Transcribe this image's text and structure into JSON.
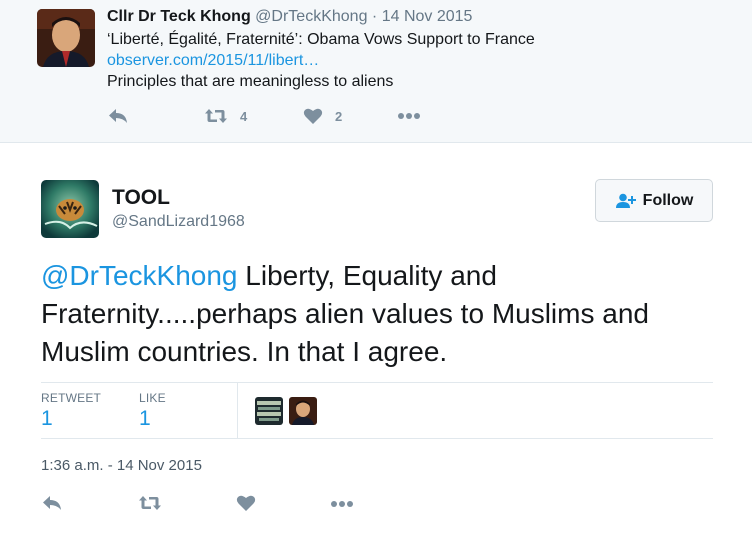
{
  "parent": {
    "name": "Cllr Dr Teck Khong",
    "handle": "@DrTeckKhong",
    "separator": "·",
    "date": "14 Nov 2015",
    "line1": "‘Liberté, Égalité, Fraternité’: Obama Vows Support to France",
    "link": "observer.com/2015/11/libert…",
    "line3": "Principles that are meaningless to aliens",
    "retweet_count": "4",
    "like_count": "2"
  },
  "tweet": {
    "name": "TOOL",
    "handle": "@SandLizard1968",
    "follow_label": "Follow",
    "mention": "@DrTeckKhong",
    "text": " Liberty, Equality and Fraternity.....perhaps alien values to Muslims and Muslim countries. In that I agree.",
    "retweet_label": "RETWEET",
    "retweet_value": "1",
    "like_label": "LIKE",
    "like_value": "1",
    "timestamp": "1:36 a.m. - 14 Nov 2015"
  },
  "icons": {
    "reply": "reply-icon",
    "retweet": "retweet-icon",
    "like": "heart-icon",
    "more": "more-icon",
    "follow": "add-user-icon"
  },
  "colors": {
    "link": "#1b95e0",
    "muted": "#657786",
    "icon": "#7d8f9e",
    "parent_bg": "#f5f8fa"
  }
}
